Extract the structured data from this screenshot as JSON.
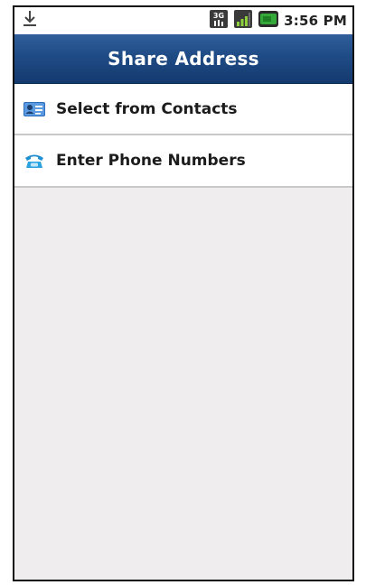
{
  "status_bar": {
    "time": "3:56 PM",
    "icons": [
      "download-icon",
      "network-3g-icon",
      "signal-icon",
      "battery-icon"
    ]
  },
  "header": {
    "title": "Share Address"
  },
  "menu": {
    "items": [
      {
        "label": "Select from Contacts",
        "icon": "contacts-card-icon"
      },
      {
        "label": "Enter Phone Numbers",
        "icon": "phone-icon"
      }
    ]
  },
  "colors": {
    "title_bar": "#1f4b85",
    "background": "#efeded",
    "item_background": "#ffffff",
    "battery": "#35a83a"
  }
}
